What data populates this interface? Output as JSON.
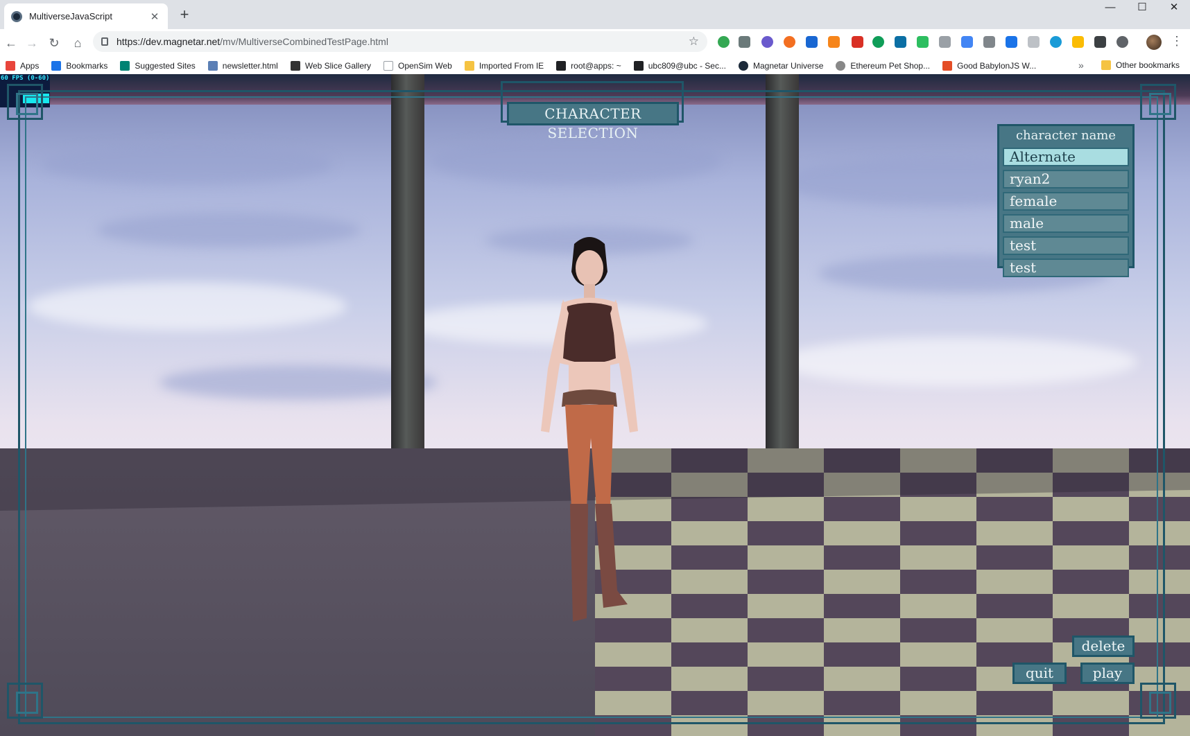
{
  "browser": {
    "tab_title": "MultiverseJavaScript",
    "new_tab": "+",
    "url_host": "https://dev.magnetar.net",
    "url_path": "/mv/MultiverseCombinedTestPage.html",
    "window_controls": [
      "—",
      "☐",
      "✕"
    ]
  },
  "bookmarks": [
    {
      "label": "Apps",
      "icon": "apps-grid-icon",
      "color": "#e8453c"
    },
    {
      "label": "Bookmarks",
      "icon": "star-icon",
      "color": "#1a73e8"
    },
    {
      "label": "Suggested Sites",
      "icon": "bing-icon",
      "color": "#008373"
    },
    {
      "label": "newsletter.html",
      "icon": "page-icon",
      "color": "#5b7fb5"
    },
    {
      "label": "Web Slice Gallery",
      "icon": "webslice-icon",
      "color": "#333333"
    },
    {
      "label": "OpenSim Web",
      "icon": "doc-icon",
      "color": "#9aa0a6"
    },
    {
      "label": "Imported From IE",
      "icon": "folder-icon",
      "color": "#f5c342"
    },
    {
      "label": "root@apps: ~",
      "icon": "terminal-icon",
      "color": "#202124"
    },
    {
      "label": "ubc809@ubc - Sec...",
      "icon": "terminal-icon",
      "color": "#202124"
    },
    {
      "label": "Magnetar Universe",
      "icon": "magnetar-icon",
      "color": "#1c2a3a"
    },
    {
      "label": "Ethereum Pet Shop...",
      "icon": "ethereum-icon",
      "color": "#888888"
    },
    {
      "label": "Good BabylonJS W...",
      "icon": "html5-icon",
      "color": "#e44d26"
    }
  ],
  "bookmarks_more": "»",
  "other_bookmarks": "Other bookmarks",
  "game": {
    "fps_label": "60 FPS (0-60)",
    "title": "CHARACTER SELECTION",
    "character_panel": {
      "header": "character name",
      "characters": [
        "Alternate",
        "ryan2",
        "female",
        "male",
        "test",
        "test"
      ],
      "selected_index": 0
    },
    "buttons": {
      "delete": "delete",
      "quit": "quit",
      "play": "play"
    },
    "colors": {
      "panel": "#477685",
      "border": "#1f5668",
      "selected": "#a9dde1"
    }
  }
}
